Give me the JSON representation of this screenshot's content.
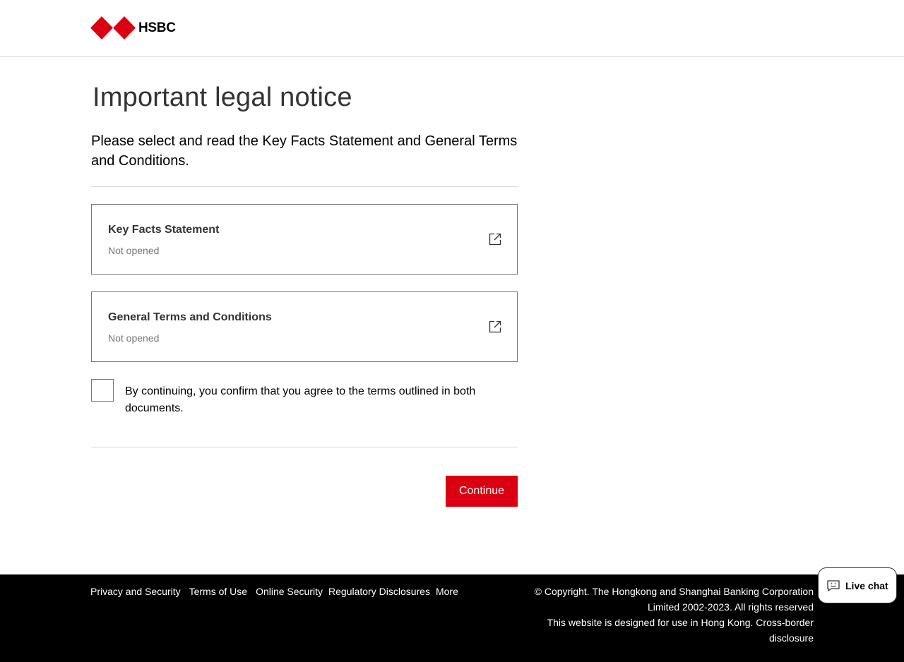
{
  "header": {
    "logo_text": "HSBC",
    "brand_color": "#db0011"
  },
  "main": {
    "title": "Important legal notice",
    "intro": "Please select and read the Key Facts Statement and General Terms and Conditions.",
    "documents": [
      {
        "title": "Key Facts Statement",
        "status": "Not opened",
        "icon": "external-link-icon"
      },
      {
        "title": "General Terms and Conditions",
        "status": "Not opened",
        "icon": "external-link-icon"
      }
    ],
    "consent_text": "By continuing, you confirm that you agree to the terms outlined in both documents.",
    "consent_checked": false,
    "continue_label": "Continue"
  },
  "footer": {
    "links": [
      "Privacy and Security",
      "Terms of Use",
      "Online Security",
      "Regulatory Disclosures",
      "More"
    ],
    "copyright": "© Copyright. The Hongkong and Shanghai Banking Corporation Limited 2002-2023. All rights reserved",
    "disclosure": "This website is designed for use in Hong Kong. Cross-border disclosure"
  },
  "live_chat": {
    "label": "Live chat",
    "icon": "chat-icon"
  }
}
